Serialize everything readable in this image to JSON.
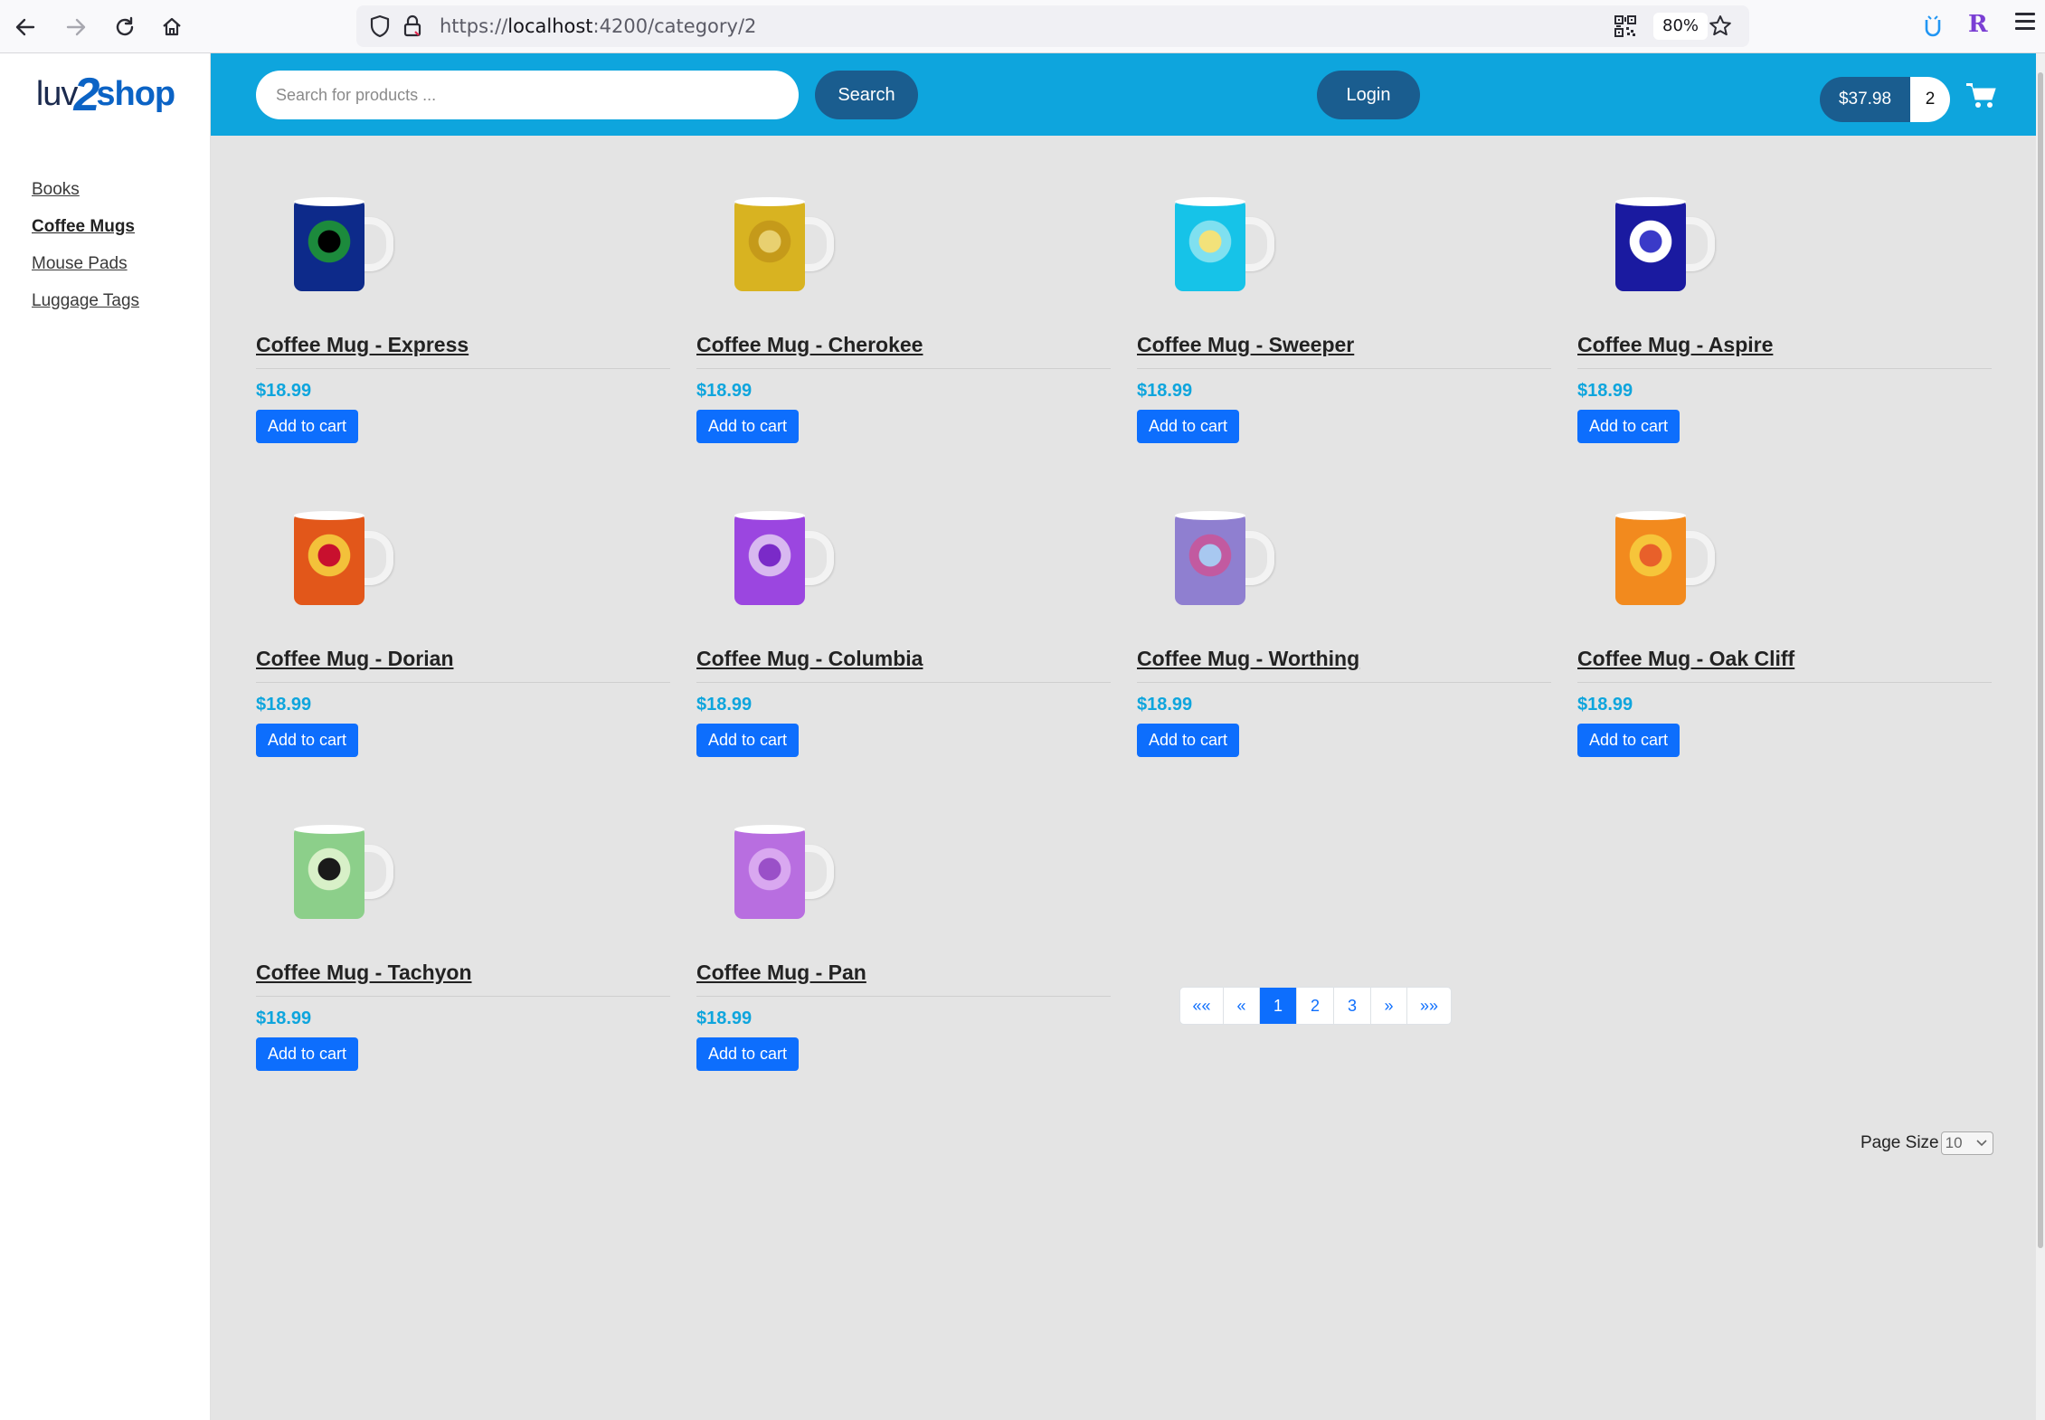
{
  "browser": {
    "url_prefix": "https://",
    "url_host": "localhost",
    "url_path": ":4200/category/2",
    "zoom": "80%"
  },
  "logo": {
    "part1": "luv",
    "part2": "2",
    "part3": "shop"
  },
  "sidebar": {
    "items": [
      {
        "label": "Books",
        "active": false
      },
      {
        "label": "Coffee Mugs",
        "active": true
      },
      {
        "label": "Mouse Pads",
        "active": false
      },
      {
        "label": "Luggage Tags",
        "active": false
      }
    ]
  },
  "header": {
    "search_placeholder": "Search for products ...",
    "search_label": "Search",
    "login_label": "Login",
    "cart_total": "$37.98",
    "cart_quantity": "2"
  },
  "products": [
    {
      "name": "Coffee Mug - Express",
      "price": "$18.99",
      "button": "Add to cart",
      "colors": [
        "#0d2a8a",
        "#1c8a3c",
        "#000000"
      ]
    },
    {
      "name": "Coffee Mug - Cherokee",
      "price": "$18.99",
      "button": "Add to cart",
      "colors": [
        "#d8b321",
        "#c59a1a",
        "#e8d070"
      ]
    },
    {
      "name": "Coffee Mug - Sweeper",
      "price": "$18.99",
      "button": "Add to cart",
      "colors": [
        "#16c3e8",
        "#7fe0f0",
        "#f2e27a"
      ]
    },
    {
      "name": "Coffee Mug - Aspire",
      "price": "$18.99",
      "button": "Add to cart",
      "colors": [
        "#1a1aa0",
        "#ffffff",
        "#3a3ac8"
      ]
    },
    {
      "name": "Coffee Mug - Dorian",
      "price": "$18.99",
      "button": "Add to cart",
      "colors": [
        "#e2571a",
        "#f3c13a",
        "#c8102e"
      ]
    },
    {
      "name": "Coffee Mug - Columbia",
      "price": "$18.99",
      "button": "Add to cart",
      "colors": [
        "#9b46e0",
        "#d8b8f0",
        "#7a2ac8"
      ]
    },
    {
      "name": "Coffee Mug - Worthing",
      "price": "$18.99",
      "button": "Add to cart",
      "colors": [
        "#8f7fd0",
        "#c25aa0",
        "#a8c8f0"
      ]
    },
    {
      "name": "Coffee Mug - Oak Cliff",
      "price": "$18.99",
      "button": "Add to cart",
      "colors": [
        "#f28a1e",
        "#f6c53a",
        "#e8602a"
      ]
    },
    {
      "name": "Coffee Mug - Tachyon",
      "price": "$18.99",
      "button": "Add to cart",
      "colors": [
        "#8ccf8a",
        "#d8f0c8",
        "#1a1a1a"
      ]
    },
    {
      "name": "Coffee Mug - Pan",
      "price": "$18.99",
      "button": "Add to cart",
      "colors": [
        "#b86ee0",
        "#d9a8f0",
        "#9a50c8"
      ]
    }
  ],
  "pagination": {
    "first": "««",
    "prev": "«",
    "pages": [
      "1",
      "2",
      "3"
    ],
    "current": "1",
    "next": "»",
    "last": "»»"
  },
  "page_size": {
    "label": "Page Size",
    "value": "10"
  }
}
